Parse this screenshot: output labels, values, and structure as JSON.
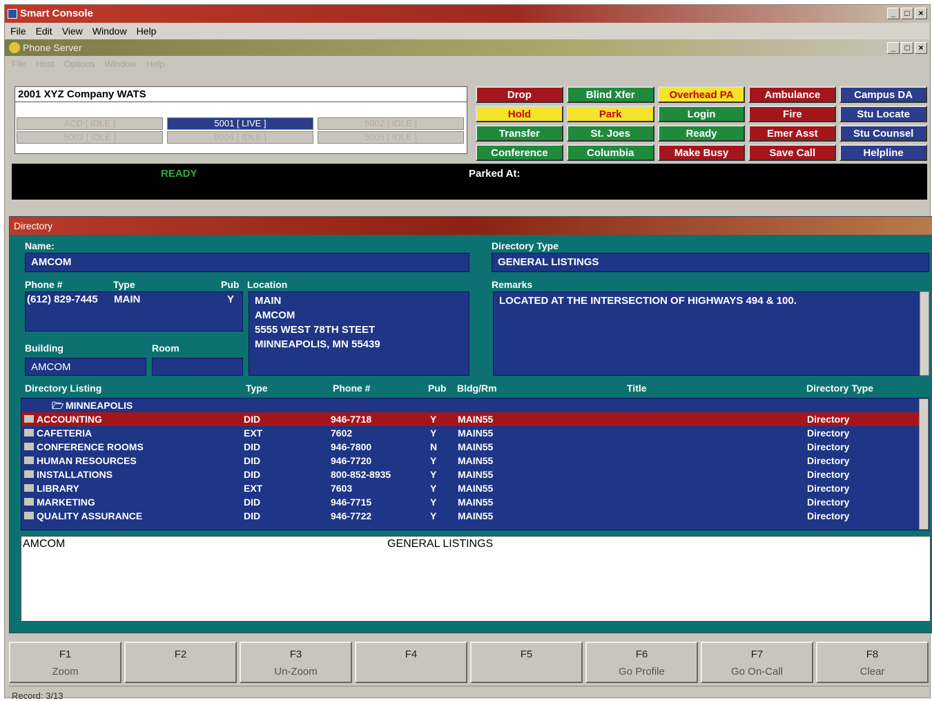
{
  "app": {
    "title": "Smart Console",
    "menu": [
      "File",
      "Edit",
      "View",
      "Window",
      "Help"
    ]
  },
  "phone_server": {
    "title": "Phone Server",
    "menu": [
      "File",
      "Host",
      "Options",
      "Window",
      "Help"
    ],
    "line_info": "2001 XYZ Company  WATS",
    "lines": [
      "ACD [ IDLE ]",
      "5001 [ LIVE ]",
      "5002 [ IDLE ]",
      "5003 [ IDLE ]",
      "5004 [ IDLE ]",
      "5005 [ IDLE ]"
    ],
    "buttons": [
      {
        "label": "Drop",
        "color": "red"
      },
      {
        "label": "Blind Xfer",
        "color": "green"
      },
      {
        "label": "Overhead PA",
        "color": "yellow"
      },
      {
        "label": "Ambulance",
        "color": "red"
      },
      {
        "label": "Campus DA",
        "color": "blue"
      },
      {
        "label": "Hold",
        "color": "yellow"
      },
      {
        "label": "Park",
        "color": "yellow"
      },
      {
        "label": "Login",
        "color": "green"
      },
      {
        "label": "Fire",
        "color": "red"
      },
      {
        "label": "Stu Locate",
        "color": "blue"
      },
      {
        "label": "Transfer",
        "color": "green"
      },
      {
        "label": "St. Joes",
        "color": "green"
      },
      {
        "label": "Ready",
        "color": "green"
      },
      {
        "label": "Emer Asst",
        "color": "red"
      },
      {
        "label": "Stu Counsel",
        "color": "blue"
      },
      {
        "label": "Conference",
        "color": "green"
      },
      {
        "label": "Columbia",
        "color": "green"
      },
      {
        "label": "Make Busy",
        "color": "red"
      },
      {
        "label": "Save Call",
        "color": "red"
      },
      {
        "label": "Helpline",
        "color": "blue"
      }
    ],
    "status": "READY",
    "parked_label": "Parked At:"
  },
  "directory": {
    "title": "Directory",
    "name_label": "Name:",
    "name_value": "AMCOM",
    "dirtype_label": "Directory Type",
    "dirtype_value": "GENERAL LISTINGS",
    "phone_label": "Phone #",
    "type_label": "Type",
    "pub_label": "Pub",
    "location_label": "Location",
    "remarks_label": "Remarks",
    "phone_value": "(612) 829-7445",
    "type_value": "MAIN",
    "pub_value": "Y",
    "location_lines": [
      "MAIN",
      "AMCOM",
      "5555 WEST 78TH STEET",
      "MINNEAPOLIS, MN   55439"
    ],
    "remarks_value": "LOCATED AT THE INTERSECTION OF HIGHWAYS 494 & 100.",
    "building_label": "Building",
    "room_label": "Room",
    "building_value": "AMCOM",
    "room_value": "",
    "list_headers": [
      "Directory Listing",
      "Type",
      "Phone #",
      "Pub",
      "Bldg/Rm",
      "Title",
      "Directory Type"
    ],
    "group": "MINNEAPOLIS",
    "rows": [
      {
        "name": "ACCOUNTING",
        "type": "DID",
        "phone": "946-7718",
        "pub": "Y",
        "bldg": "MAIN55",
        "dtype": "Directory"
      },
      {
        "name": "CAFETERIA",
        "type": "EXT",
        "phone": "7602",
        "pub": "Y",
        "bldg": "MAIN55",
        "dtype": "Directory"
      },
      {
        "name": "CONFERENCE ROOMS",
        "type": "DID",
        "phone": "946-7800",
        "pub": "N",
        "bldg": "MAIN55",
        "dtype": "Directory"
      },
      {
        "name": "HUMAN RESOURCES",
        "type": "DID",
        "phone": "946-7720",
        "pub": "Y",
        "bldg": "MAIN55",
        "dtype": "Directory"
      },
      {
        "name": "INSTALLATIONS",
        "type": "DID",
        "phone": "800-852-8935",
        "pub": "Y",
        "bldg": "MAIN55",
        "dtype": "Directory"
      },
      {
        "name": "LIBRARY",
        "type": "EXT",
        "phone": "7603",
        "pub": "Y",
        "bldg": "MAIN55",
        "dtype": "Directory"
      },
      {
        "name": "MARKETING",
        "type": "DID",
        "phone": "946-7715",
        "pub": "Y",
        "bldg": "MAIN55",
        "dtype": "Directory"
      },
      {
        "name": "QUALITY ASSURANCE",
        "type": "DID",
        "phone": "946-7722",
        "pub": "Y",
        "bldg": "MAIN55",
        "dtype": "Directory"
      }
    ],
    "footer_name": "AMCOM",
    "footer_type": "GENERAL LISTINGS"
  },
  "fkeys": [
    {
      "key": "F1",
      "label": "Zoom"
    },
    {
      "key": "F2",
      "label": ""
    },
    {
      "key": "F3",
      "label": "Un-Zoom"
    },
    {
      "key": "F4",
      "label": ""
    },
    {
      "key": "F5",
      "label": ""
    },
    {
      "key": "F6",
      "label": "Go Profile"
    },
    {
      "key": "F7",
      "label": "Go On-Call"
    },
    {
      "key": "F8",
      "label": "Clear"
    }
  ],
  "record": "Record: 3/13",
  "colors": {
    "red": "#a4161c",
    "green": "#1f8a3c",
    "yellow": "#f4e42c",
    "blue": "#2c3d8c",
    "teal": "#0d7171"
  }
}
